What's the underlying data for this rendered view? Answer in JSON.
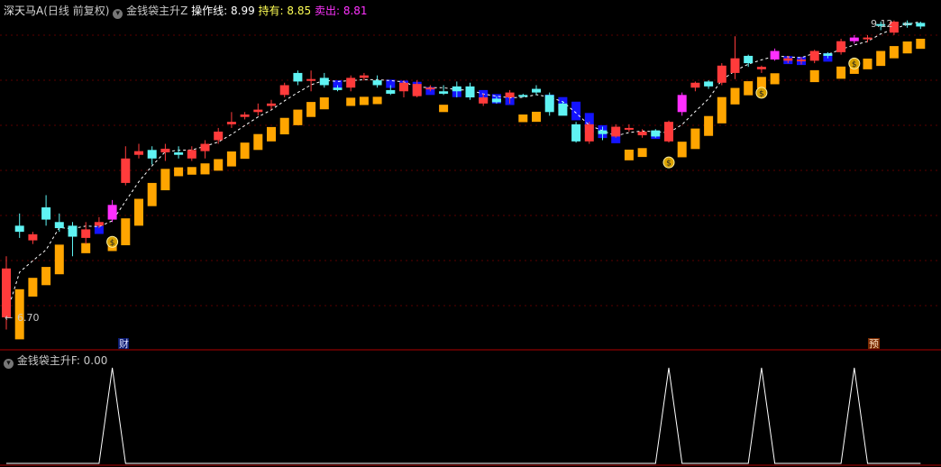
{
  "header": {
    "stock": "深天马A",
    "period": "(日线 前复权)",
    "indicator": "金钱袋主升Z",
    "op_label": "操作线:",
    "op_value": "8.99",
    "hold_label": "持有:",
    "hold_value": "8.85",
    "sell_label": "卖出:",
    "sell_value": "8.81"
  },
  "sub_header": {
    "indicator": "金钱袋主升F",
    "value_text": ": 0.00"
  },
  "markers": {
    "cai": "财",
    "yu": "预"
  },
  "colors": {
    "background": "#000000",
    "up": "#ff3b3b",
    "down": "#5ff3f3",
    "magenta": "#ff2fff",
    "blue": "#1414ff",
    "orange": "#ffa500",
    "divider": "#b00000",
    "ref_line": "#ffffff",
    "sell_text": "#ff33ff",
    "hold_text": "#ffff55"
  },
  "chart_data": [
    {
      "type": "candlestick",
      "price_labels": {
        "high": "9.12",
        "low": "6.70"
      },
      "candles": [
        [
          7.1,
          6.7,
          6.6,
          7.2,
          "up"
        ],
        [
          7.45,
          7.4,
          7.35,
          7.55,
          "down"
        ],
        [
          7.38,
          7.33,
          7.3,
          7.4,
          "up"
        ],
        [
          7.6,
          7.5,
          7.45,
          7.7,
          "down"
        ],
        [
          7.48,
          7.43,
          7.4,
          7.55,
          "down"
        ],
        [
          7.45,
          7.36,
          7.2,
          7.48,
          "down"
        ],
        [
          7.35,
          7.42,
          7.3,
          7.48,
          "up"
        ],
        [
          7.45,
          7.48,
          7.43,
          7.52,
          "up"
        ],
        [
          7.5,
          7.62,
          7.48,
          7.66,
          "magenta"
        ],
        [
          7.8,
          8.0,
          7.78,
          8.1,
          "up"
        ],
        [
          8.03,
          8.06,
          8.0,
          8.12,
          "up"
        ],
        [
          8.07,
          8.0,
          7.95,
          8.1,
          "down"
        ],
        [
          8.05,
          8.08,
          7.98,
          8.12,
          "up"
        ],
        [
          8.03,
          8.05,
          8.0,
          8.1,
          "down"
        ],
        [
          8.0,
          8.07,
          7.98,
          8.1,
          "up"
        ],
        [
          8.06,
          8.12,
          8.0,
          8.15,
          "up"
        ],
        [
          8.15,
          8.22,
          8.12,
          8.25,
          "up"
        ],
        [
          8.28,
          8.3,
          8.25,
          8.38,
          "up"
        ],
        [
          8.34,
          8.36,
          8.32,
          8.38,
          "up"
        ],
        [
          8.38,
          8.4,
          8.35,
          8.45,
          "up"
        ],
        [
          8.43,
          8.45,
          8.4,
          8.48,
          "up"
        ],
        [
          8.52,
          8.6,
          8.5,
          8.62,
          "up"
        ],
        [
          8.7,
          8.63,
          8.6,
          8.72,
          "down"
        ],
        [
          8.65,
          8.65,
          8.55,
          8.72,
          "up"
        ],
        [
          8.66,
          8.6,
          8.58,
          8.7,
          "down"
        ],
        [
          8.58,
          8.56,
          8.55,
          8.6,
          "down"
        ],
        [
          8.58,
          8.66,
          8.55,
          8.68,
          "up"
        ],
        [
          8.66,
          8.68,
          8.64,
          8.7,
          "up"
        ],
        [
          8.64,
          8.6,
          8.58,
          8.68,
          "down"
        ],
        [
          8.56,
          8.53,
          8.52,
          8.6,
          "down"
        ],
        [
          8.55,
          8.62,
          8.5,
          8.64,
          "up"
        ],
        [
          8.61,
          8.51,
          8.5,
          8.64,
          "up"
        ],
        [
          8.57,
          8.58,
          8.55,
          8.6,
          "up"
        ],
        [
          8.55,
          8.53,
          8.52,
          8.6,
          "down"
        ],
        [
          8.59,
          8.55,
          8.5,
          8.63,
          "down"
        ],
        [
          8.59,
          8.5,
          8.48,
          8.62,
          "down"
        ],
        [
          8.5,
          8.45,
          8.43,
          8.53,
          "up"
        ],
        [
          8.49,
          8.46,
          8.45,
          8.51,
          "down"
        ],
        [
          8.54,
          8.5,
          8.45,
          8.56,
          "up"
        ],
        [
          8.52,
          8.51,
          8.5,
          8.53,
          "down"
        ],
        [
          8.57,
          8.54,
          8.52,
          8.6,
          "down"
        ],
        [
          8.52,
          8.38,
          8.35,
          8.54,
          "down"
        ],
        [
          8.45,
          8.35,
          8.4,
          8.47,
          "down"
        ],
        [
          8.28,
          8.14,
          8.13,
          8.3,
          "down"
        ],
        [
          8.28,
          8.14,
          8.12,
          8.3,
          "up"
        ],
        [
          8.23,
          8.2,
          8.15,
          8.26,
          "down"
        ],
        [
          8.26,
          8.18,
          8.17,
          8.28,
          "up"
        ],
        [
          8.25,
          8.25,
          8.22,
          8.28,
          "up"
        ],
        [
          8.22,
          8.19,
          8.17,
          8.24,
          "up"
        ],
        [
          8.23,
          8.18,
          8.17,
          8.24,
          "down"
        ],
        [
          8.3,
          8.14,
          8.13,
          8.31,
          "up"
        ],
        [
          8.38,
          8.52,
          8.35,
          8.54,
          "magenta"
        ],
        [
          8.58,
          8.62,
          8.55,
          8.63,
          "up"
        ],
        [
          8.63,
          8.59,
          8.57,
          8.64,
          "down"
        ],
        [
          8.62,
          8.76,
          8.6,
          8.78,
          "up"
        ],
        [
          8.7,
          8.82,
          8.65,
          9.0,
          "up"
        ],
        [
          8.78,
          8.84,
          8.75,
          8.85,
          "down"
        ],
        [
          8.75,
          8.73,
          8.7,
          8.76,
          "up"
        ],
        [
          8.81,
          8.88,
          8.8,
          8.9,
          "magenta"
        ],
        [
          8.82,
          8.8,
          8.78,
          8.84,
          "up"
        ],
        [
          8.81,
          8.81,
          8.77,
          8.83,
          "up"
        ],
        [
          8.8,
          8.88,
          8.78,
          8.89,
          "up"
        ],
        [
          8.86,
          8.84,
          8.82,
          8.87,
          "down"
        ],
        [
          8.87,
          8.96,
          8.85,
          8.98,
          "up"
        ],
        [
          8.99,
          8.96,
          8.94,
          9.01,
          "magenta"
        ],
        [
          8.98,
          8.99,
          8.95,
          9.01,
          "up"
        ],
        [
          9.1,
          9.09,
          9.05,
          9.12,
          "down"
        ],
        [
          9.03,
          9.12,
          9.01,
          9.13,
          "up"
        ],
        [
          9.09,
          9.11,
          9.07,
          9.13,
          "down"
        ],
        [
          9.11,
          9.08,
          9.06,
          9.12,
          "down"
        ]
      ]
    },
    {
      "type": "line",
      "name": "金钱袋主升F",
      "values": [
        0,
        0,
        0,
        0,
        0,
        0,
        0,
        0,
        1,
        0,
        0,
        0,
        0,
        0,
        0,
        0,
        0,
        0,
        0,
        0,
        0,
        0,
        0,
        0,
        0,
        0,
        0,
        0,
        0,
        0,
        0,
        0,
        0,
        0,
        0,
        0,
        0,
        0,
        0,
        0,
        0,
        0,
        0,
        0,
        0,
        0,
        0,
        0,
        0,
        0,
        1,
        0,
        0,
        0,
        0,
        0,
        0,
        1,
        0,
        0,
        0,
        0,
        0,
        0,
        1,
        0,
        0,
        0,
        0,
        0
      ]
    }
  ]
}
